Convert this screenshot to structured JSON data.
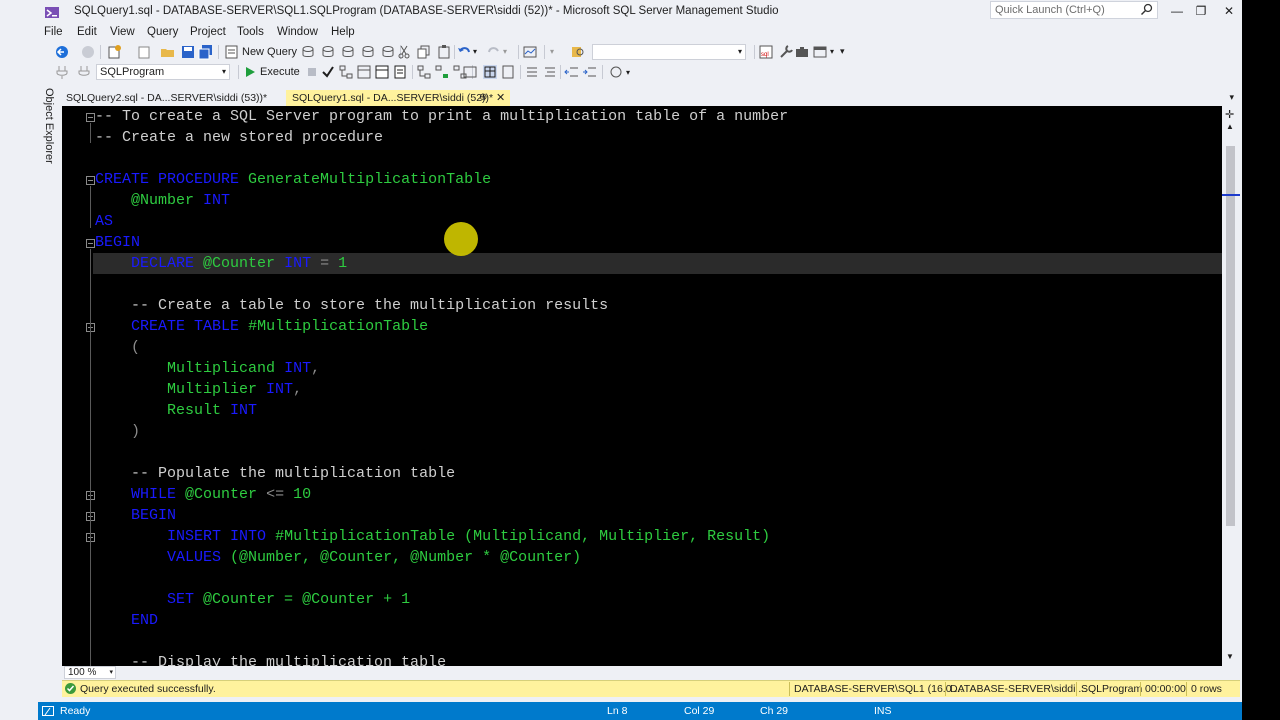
{
  "window": {
    "title": "SQLQuery1.sql - DATABASE-SERVER\\SQL1.SQLProgram (DATABASE-SERVER\\siddi (52))* - Microsoft SQL Server Management Studio",
    "quick_launch_placeholder": "Quick Launch (Ctrl+Q)"
  },
  "menu": [
    "File",
    "Edit",
    "View",
    "Query",
    "Project",
    "Tools",
    "Window",
    "Help"
  ],
  "toolbar": {
    "new_query": "New Query",
    "database": "SQLProgram",
    "execute": "Execute"
  },
  "object_explorer_label": "Object Explorer",
  "tabs": [
    {
      "label": "SQLQuery2.sql - DA...SERVER\\siddi (53))*",
      "active": false
    },
    {
      "label": "SQLQuery1.sql - DA...SERVER\\siddi (52))*",
      "active": true
    }
  ],
  "code": {
    "l1": "-- To create a SQL Server program to print a multiplication table of a number",
    "l2": "-- Create a new stored procedure",
    "l4_kw": "CREATE PROCEDURE",
    "l4_id": "GenerateMultiplicationTable",
    "l5_id": "@Number",
    "l5_kw": "INT",
    "l6": "AS",
    "l7": "BEGIN",
    "l8_kw1": "DECLARE",
    "l8_id": "@Counter",
    "l8_kw2": "INT",
    "l8_op": "=",
    "l8_val": "1",
    "l10": "-- Create a table to store the multiplication results",
    "l11_kw": "CREATE TABLE",
    "l11_id": "#MultiplicationTable",
    "l12": "(",
    "l13_id": "Multiplicand",
    "l13_kw": "INT",
    "l13_p": ",",
    "l14_id": "Multiplier",
    "l14_kw": "INT",
    "l14_p": ",",
    "l15_id": "Result",
    "l15_kw": "INT",
    "l16": ")",
    "l18": "-- Populate the multiplication table",
    "l19_kw": "WHILE",
    "l19_id": "@Counter",
    "l19_op": "<=",
    "l19_val": "10",
    "l20": "BEGIN",
    "l21_kw": "INSERT INTO",
    "l21_id": "#MultiplicationTable",
    "l21_rest": "(Multiplicand, Multiplier, Result)",
    "l22_kw": "VALUES",
    "l22_rest": "(@Number, @Counter, @Number * @Counter)",
    "l24_kw": "SET",
    "l24_rest": "@Counter = @Counter + 1",
    "l25": "END",
    "l27": "-- Display the multiplication table"
  },
  "zoom": "100 %",
  "query_status": {
    "message": "Query executed successfully.",
    "server": "DATABASE-SERVER\\SQL1 (16.0 ...",
    "user": "DATABASE-SERVER\\siddi ...",
    "database": "SQLProgram",
    "elapsed": "00:00:00",
    "rows": "0 rows"
  },
  "statusbar": {
    "state": "Ready",
    "ln": "Ln 8",
    "col": "Col 29",
    "ch": "Ch 29",
    "mode": "INS"
  },
  "colors": {
    "keyword": "#1a1aff",
    "identifier": "#2ecc40",
    "comment": "#cfcfcf",
    "status_blue": "#007acc",
    "tab_active": "#fff29d"
  }
}
